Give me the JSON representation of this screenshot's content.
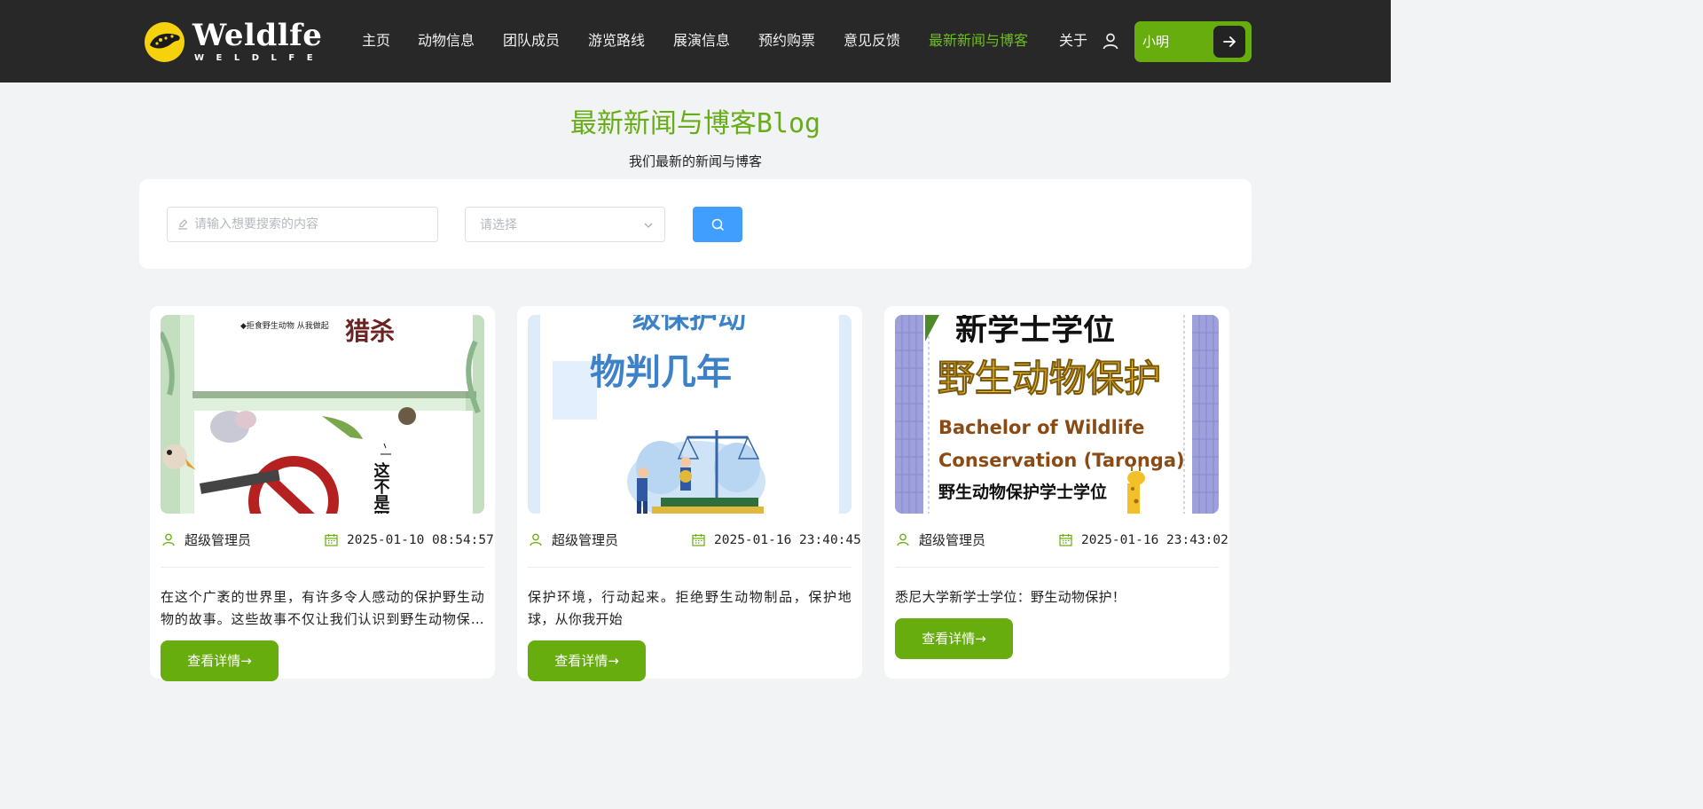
{
  "brand": {
    "title": "Weldlfe",
    "subtitle": "WELDLFE"
  },
  "nav": [
    {
      "label": "主页"
    },
    {
      "label": "动物信息"
    },
    {
      "label": "团队成员"
    },
    {
      "label": "游览路线"
    },
    {
      "label": "展演信息"
    },
    {
      "label": "预约购票"
    },
    {
      "label": "意见反馈"
    },
    {
      "label": "最新新闻与博客",
      "active": true
    },
    {
      "label": "关于"
    }
  ],
  "user": {
    "name": "小明",
    "icon": "user-icon",
    "logout_icon": "arrow-right-icon"
  },
  "colors": {
    "accent": "#67ad0e",
    "header_bg": "#282828",
    "search_button": "#409eff"
  },
  "page": {
    "title": "最新新闻与博客Blog",
    "subtitle": "我们最新的新闻与博客"
  },
  "search": {
    "placeholder": "请输入想要搜索的内容",
    "select_placeholder": "请选择"
  },
  "posts": [
    {
      "author": "超级管理员",
      "date": "2025-01-10 08:54:57",
      "summary": "在这个广袤的世界里，有许多令人感动的保护野生动物的故事。这些故事不仅让我们认识到野生动物保护的重要性，也激励着更多人加入其中。",
      "button": "查看详情→",
      "image_text": {
        "top_small": "◆拒食野生动物  从我做起",
        "headline": "猎杀",
        "side": "这不是野"
      }
    },
    {
      "author": "超级管理员",
      "date": "2025-01-16 23:40:45",
      "summary": "保护环境，行动起来。拒绝野生动物制品，保护地球，从你我开始",
      "button": "查看详情→",
      "image_text": {
        "line1": "级保护动",
        "line2": "物判几年"
      }
    },
    {
      "author": "超级管理员",
      "date": "2025-01-16 23:43:02",
      "summary": "悉尼大学新学士学位：野生动物保护！",
      "button": "查看详情→",
      "image_text": {
        "line1": "新学士学位",
        "line2": "野生动物保护",
        "line3": "Bachelor of Wildlife",
        "line4": "Conservation (Taronga)",
        "line5": "野生动物保护学士学位"
      }
    }
  ]
}
